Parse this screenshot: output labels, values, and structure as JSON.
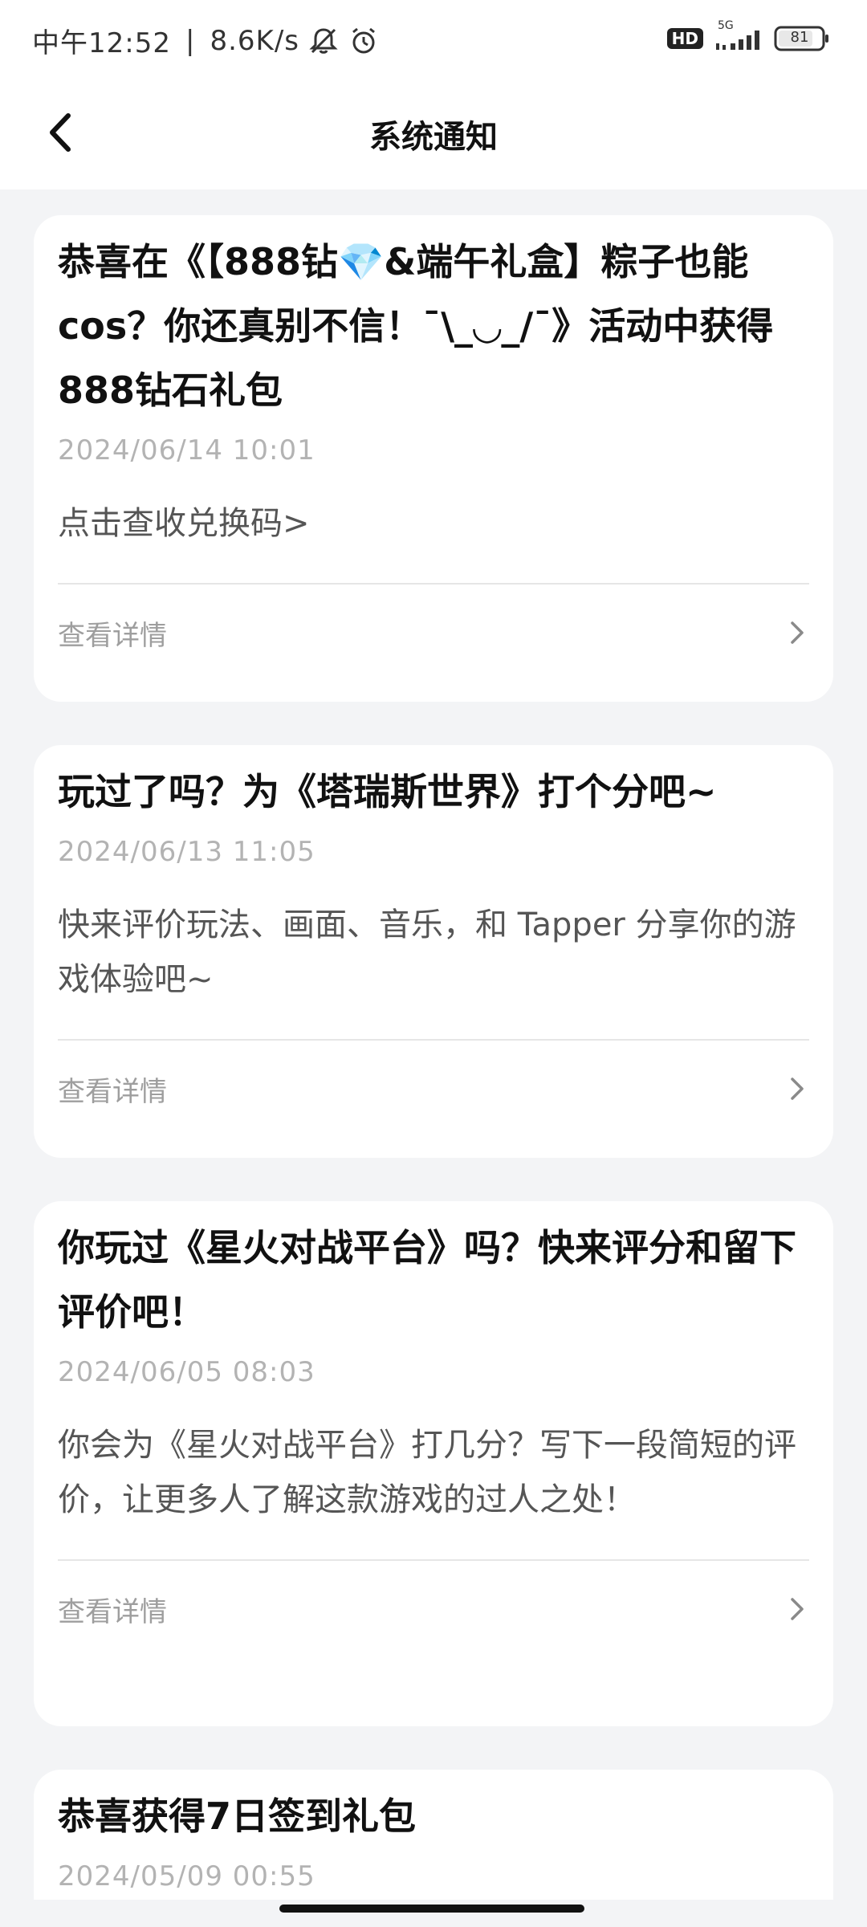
{
  "status_bar": {
    "time": "中午12:52",
    "separator": "|",
    "net_speed": "8.6K/s",
    "network_type": "5G",
    "hd_label": "HD",
    "battery": "81",
    "icons": [
      "bell-muted-icon",
      "alarm-icon",
      "signal-icon",
      "battery-icon"
    ]
  },
  "header": {
    "title": "系统通知",
    "back_icon": "chevron-left-icon"
  },
  "notifications": [
    {
      "title": "恭喜在《【888钻💎&端午礼盒】粽子也能cos？你还真别不信！¯\\_◡_/¯》活动中获得888钻石礼包",
      "date": "2024/06/14 10:01",
      "body": "点击查收兑换码>",
      "footer": "查看详情"
    },
    {
      "title": "玩过了吗？为《塔瑞斯世界》打个分吧~",
      "date": "2024/06/13 11:05",
      "body": "快来评价玩法、画面、音乐，和 Tapper 分享你的游戏体验吧~",
      "footer": "查看详情"
    },
    {
      "title": "你玩过《星火对战平台》吗？快来评分和留下评价吧！",
      "date": "2024/06/05 08:03",
      "body": "你会为《星火对战平台》打几分？写下一段简短的评价，让更多人了解这款游戏的过人之处！",
      "footer": "查看详情"
    },
    {
      "title": "恭喜获得7日签到礼包",
      "date": "2024/05/09 00:55"
    }
  ],
  "colors": {
    "background": "#f3f4f6",
    "card": "#ffffff",
    "title_text": "#111111",
    "date_text": "#b3b3b3",
    "body_text": "#555555",
    "footer_text": "#9e9e9e"
  }
}
